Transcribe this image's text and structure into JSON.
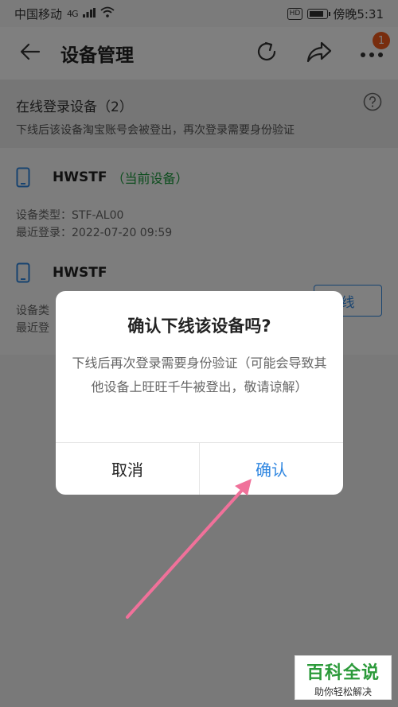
{
  "status_bar": {
    "carrier": "中国移动",
    "network": "4G",
    "hd": "HD",
    "time": "傍晚5:31",
    "battery_level": 0.7
  },
  "app_bar": {
    "title": "设备管理",
    "icons": [
      "back-arrow-icon",
      "refresh-icon",
      "share-icon",
      "more-icon"
    ],
    "notification_count": "1"
  },
  "section": {
    "title": "在线登录设备（2）",
    "description": "下线后该设备淘宝账号会被登出，再次登录需要身份验证"
  },
  "devices": [
    {
      "name": "HWSTF",
      "tag": "（当前设备）",
      "type_line": "设备类型：STF-AL00",
      "last_login_line": "最近登录：2022-07-20 09:59"
    },
    {
      "name": "HWSTF",
      "type_line": "设备类",
      "last_login_line": "最近登",
      "action": "线"
    }
  ],
  "dialog": {
    "title": "确认下线该设备吗?",
    "body": "下线后再次登录需要身份验证（可能会导致其他设备上旺旺千牛被登出，敬请谅解）",
    "cancel": "取消",
    "confirm": "确认"
  },
  "watermark": {
    "main": "百科全说",
    "sub": "助你轻松解决"
  },
  "colors": {
    "accent_blue": "#2f86e0",
    "current_green": "#1a9a3c",
    "badge_orange": "#f05b1c",
    "annotation_pink": "#f0719a"
  }
}
